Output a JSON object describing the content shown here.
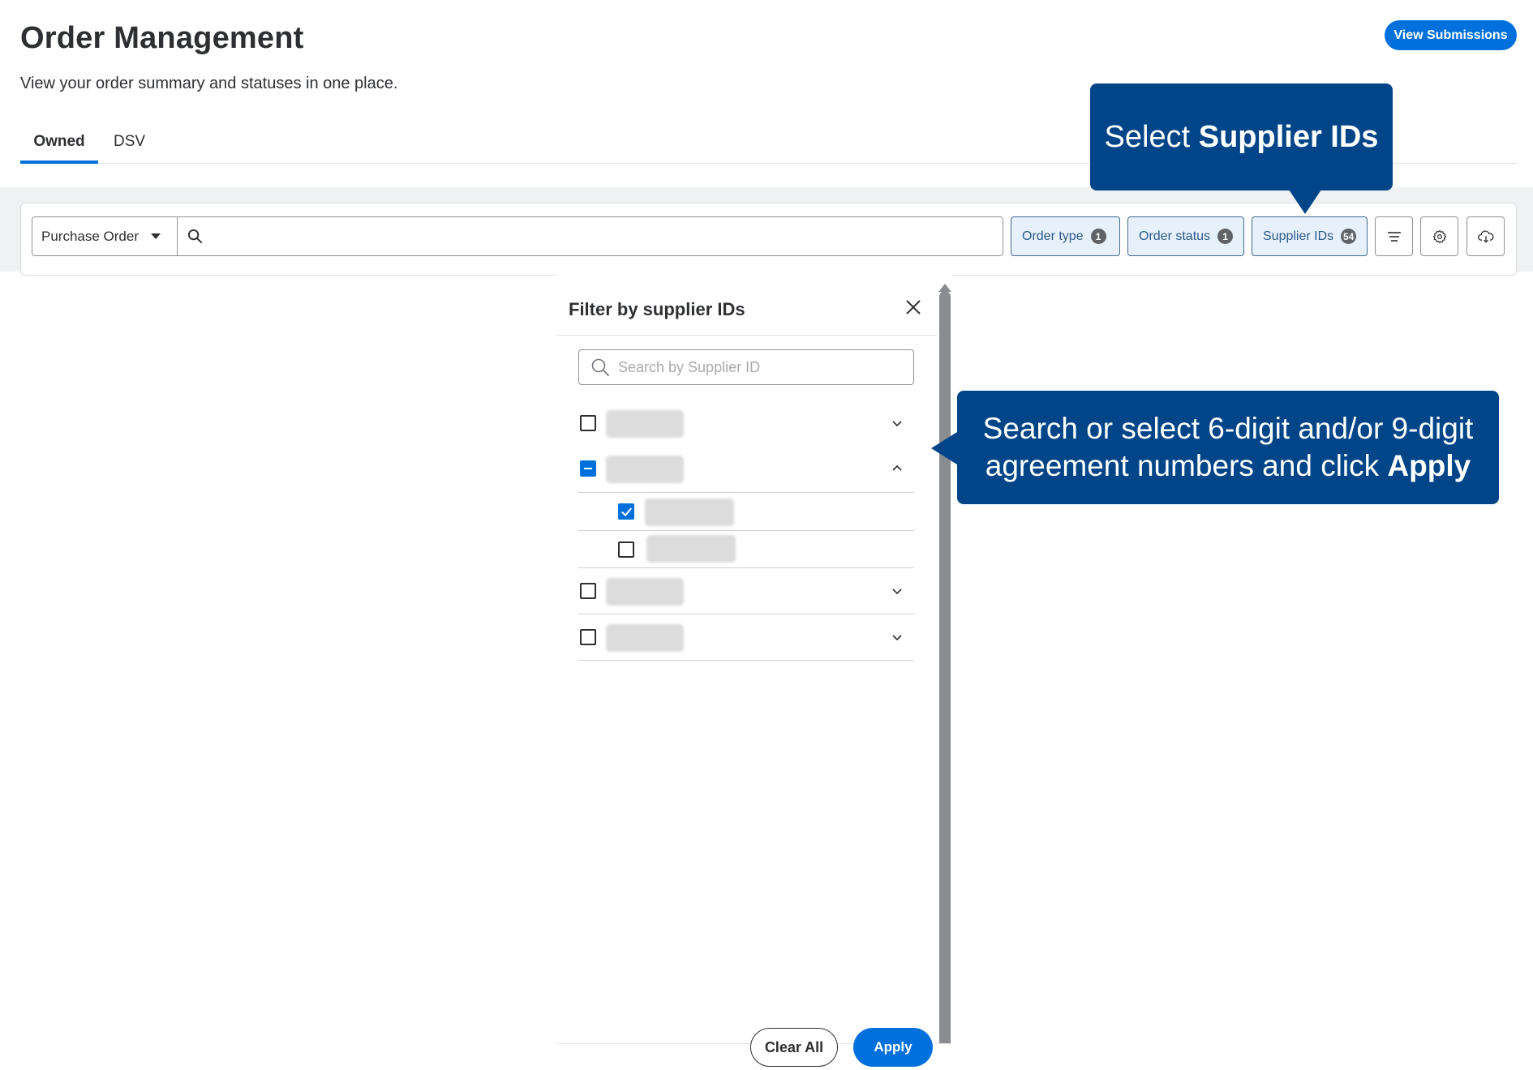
{
  "header": {
    "title": "Order Management",
    "subtitle": "View your order summary and statuses in one place.",
    "view_submissions_label": "View Submissions"
  },
  "tabs": [
    {
      "label": "Owned",
      "active": true
    },
    {
      "label": "DSV",
      "active": false
    }
  ],
  "toolbar": {
    "search_type": "Purchase Order",
    "search_value": "",
    "filters": [
      {
        "label": "Order type",
        "count": "1"
      },
      {
        "label": "Order status",
        "count": "1"
      },
      {
        "label": "Supplier IDs",
        "count": "54"
      }
    ],
    "icons": [
      "filter-list-icon",
      "gear-icon",
      "cloud-download-icon"
    ]
  },
  "filter_panel": {
    "title": "Filter by supplier IDs",
    "search_placeholder": "Search by Supplier ID",
    "groups": [
      {
        "state": "unchecked",
        "expanded": false,
        "children": []
      },
      {
        "state": "indeterminate",
        "expanded": true,
        "children": [
          {
            "state": "checked"
          },
          {
            "state": "unchecked"
          }
        ]
      },
      {
        "state": "unchecked",
        "expanded": false,
        "children": []
      },
      {
        "state": "unchecked",
        "expanded": false,
        "children": []
      }
    ],
    "clear_all_label": "Clear All",
    "apply_label": "Apply"
  },
  "callouts": {
    "select_pre": "Select ",
    "select_bold": "Supplier IDs",
    "search_line1": "Search or select 6-digit and/or 9-digit",
    "search_line2_pre": "agreement numbers and click ",
    "search_line2_bold": "Apply"
  },
  "colors": {
    "primary": "#0071dc",
    "callout": "#004587",
    "chip_bg": "#e6f1fc"
  }
}
